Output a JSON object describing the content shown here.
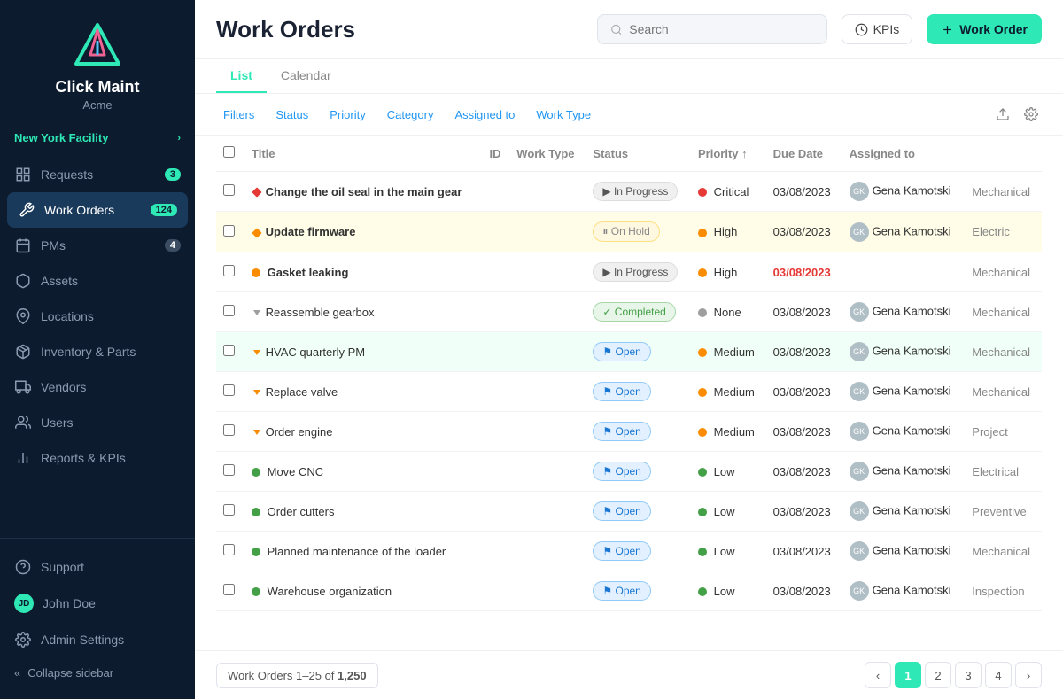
{
  "app": {
    "logo_name": "Click Maint",
    "logo_sub": "Acme"
  },
  "sidebar": {
    "facility": "New York Facility",
    "nav_items": [
      {
        "id": "requests",
        "label": "Requests",
        "badge": "3",
        "icon": "grid"
      },
      {
        "id": "work-orders",
        "label": "Work Orders",
        "badge": "124",
        "active": true,
        "icon": "tool"
      },
      {
        "id": "pms",
        "label": "PMs",
        "badge": "4",
        "icon": "calendar"
      },
      {
        "id": "assets",
        "label": "Assets",
        "icon": "box"
      },
      {
        "id": "locations",
        "label": "Locations",
        "icon": "map-pin"
      },
      {
        "id": "inventory",
        "label": "Inventory & Parts",
        "icon": "package"
      },
      {
        "id": "vendors",
        "label": "Vendors",
        "icon": "truck"
      },
      {
        "id": "users",
        "label": "Users",
        "icon": "users"
      },
      {
        "id": "reports",
        "label": "Reports & KPIs",
        "icon": "bar-chart"
      }
    ],
    "bottom_items": [
      {
        "id": "support",
        "label": "Support",
        "icon": "help-circle"
      }
    ],
    "user": {
      "name": "John Doe",
      "label": "Admin Settings"
    },
    "collapse_label": "Collapse sidebar"
  },
  "header": {
    "title": "Work Orders",
    "search_placeholder": "Search",
    "kpi_label": "KPIs",
    "add_label": "Work Order"
  },
  "tabs": [
    {
      "id": "list",
      "label": "List",
      "active": true
    },
    {
      "id": "calendar",
      "label": "Calendar"
    }
  ],
  "filters": [
    "Filters",
    "Status",
    "Priority",
    "Category",
    "Assigned to",
    "Work Type"
  ],
  "table": {
    "columns": [
      "Title",
      "ID",
      "Work Type",
      "Status",
      "Priority",
      "Due Date",
      "Assigned to"
    ],
    "rows": [
      {
        "title": "Change the oil seal in the main gear",
        "id": "",
        "work_type": "",
        "status": "In Progress",
        "status_class": "status-inprogress",
        "priority": "Critical",
        "priority_color": "#e53935",
        "due_date": "03/08/2023",
        "assigned": "Gena Kamotski",
        "department": "Mechanical",
        "priority_icon": "diamond",
        "row_class": ""
      },
      {
        "title": "Update firmware",
        "id": "",
        "work_type": "",
        "status": "On Hold",
        "status_class": "status-onhold",
        "priority": "High",
        "priority_color": "#fb8c00",
        "due_date": "03/08/2023",
        "assigned": "Gena Kamotski",
        "department": "Electric",
        "priority_icon": "diamond",
        "row_class": "row-highlight-yellow"
      },
      {
        "title": "Gasket leaking",
        "id": "",
        "work_type": "",
        "status": "In Progress",
        "status_class": "status-inprogress",
        "priority": "High",
        "priority_color": "#fb8c00",
        "due_date": "03/08/2023",
        "assigned": "",
        "department": "Mechanical",
        "priority_icon": "circle",
        "row_class": "",
        "overdue": true
      },
      {
        "title": "Reassemble gearbox",
        "id": "",
        "work_type": "",
        "status": "Completed",
        "status_class": "status-completed",
        "priority": "None",
        "priority_color": "#9e9e9e",
        "due_date": "03/08/2023",
        "assigned": "Gena Kamotski",
        "department": "Mechanical",
        "priority_icon": "down",
        "row_class": ""
      },
      {
        "title": "HVAC quarterly PM",
        "id": "",
        "work_type": "",
        "status": "Open",
        "status_class": "status-open",
        "priority": "Medium",
        "priority_color": "#fb8c00",
        "due_date": "03/08/2023",
        "assigned": "Gena Kamotski",
        "department": "Mechanical",
        "priority_icon": "down",
        "row_class": "row-highlight-green"
      },
      {
        "title": "Replace valve",
        "id": "",
        "work_type": "",
        "status": "Open",
        "status_class": "status-open",
        "priority": "Medium",
        "priority_color": "#fb8c00",
        "due_date": "03/08/2023",
        "assigned": "Gena Kamotski",
        "department": "Mechanical",
        "priority_icon": "down",
        "row_class": ""
      },
      {
        "title": "Order engine",
        "id": "",
        "work_type": "",
        "status": "Open",
        "status_class": "status-open",
        "priority": "Medium",
        "priority_color": "#fb8c00",
        "due_date": "03/08/2023",
        "assigned": "Gena Kamotski",
        "department": "Project",
        "priority_icon": "down",
        "row_class": ""
      },
      {
        "title": "Move CNC",
        "id": "",
        "work_type": "",
        "status": "Open",
        "status_class": "status-open",
        "priority": "Low",
        "priority_color": "#43a047",
        "due_date": "03/08/2023",
        "assigned": "Gena Kamotski",
        "department": "Electrical",
        "priority_icon": "circle-low",
        "row_class": ""
      },
      {
        "title": "Order cutters",
        "id": "",
        "work_type": "",
        "status": "Open",
        "status_class": "status-open",
        "priority": "Low",
        "priority_color": "#43a047",
        "due_date": "03/08/2023",
        "assigned": "Gena Kamotski",
        "department": "Preventive",
        "priority_icon": "circle-low",
        "row_class": ""
      },
      {
        "title": "Planned maintenance of the loader",
        "id": "",
        "work_type": "",
        "status": "Open",
        "status_class": "status-open",
        "priority": "Low",
        "priority_color": "#43a047",
        "due_date": "03/08/2023",
        "assigned": "Gena Kamotski",
        "department": "Mechanical",
        "priority_icon": "circle-low",
        "row_class": ""
      },
      {
        "title": "Warehouse organization",
        "id": "",
        "work_type": "",
        "status": "Open",
        "status_class": "status-open",
        "priority": "Low",
        "priority_color": "#43a047",
        "due_date": "03/08/2023",
        "assigned": "Gena Kamotski",
        "department": "Inspection",
        "priority_icon": "circle-low",
        "row_class": ""
      }
    ]
  },
  "footer": {
    "count_label": "Work Orders 1–25 of 1,250",
    "pages": [
      "1",
      "2",
      "3",
      "4"
    ]
  }
}
